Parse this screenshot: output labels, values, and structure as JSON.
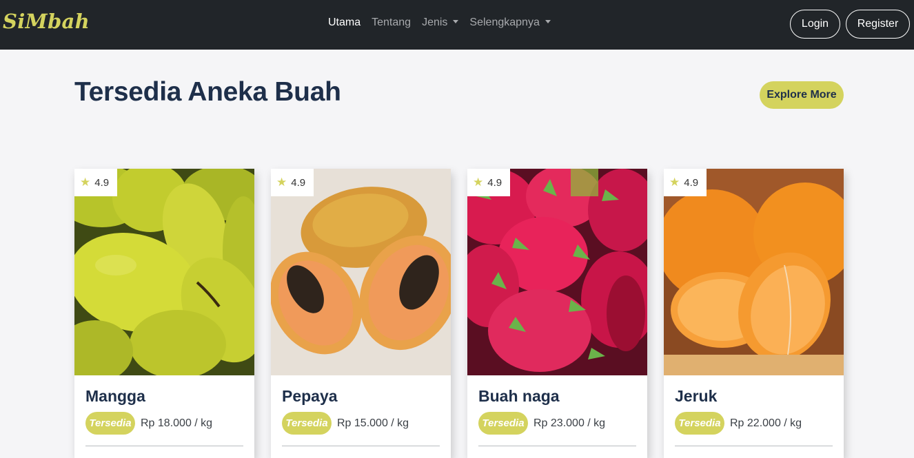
{
  "navbar": {
    "brand": "SiMbah",
    "links": [
      {
        "label": "Utama",
        "active": true,
        "dropdown": false
      },
      {
        "label": "Tentang",
        "active": false,
        "dropdown": false
      },
      {
        "label": "Jenis",
        "active": false,
        "dropdown": true
      },
      {
        "label": "Selengkapnya",
        "active": false,
        "dropdown": true
      }
    ],
    "login_label": "Login",
    "register_label": "Register"
  },
  "section": {
    "title": "Tersedia Aneka Buah",
    "explore_label": "Explore More"
  },
  "products": [
    {
      "name": "Mangga",
      "rating": "4.9",
      "status": "Tersedia",
      "price": "Rp 18.000 / kg",
      "image": "mango-photo"
    },
    {
      "name": "Pepaya",
      "rating": "4.9",
      "status": "Tersedia",
      "price": "Rp 15.000 / kg",
      "image": "papaya-photo"
    },
    {
      "name": "Buah naga",
      "rating": "4.9",
      "status": "Tersedia",
      "price": "Rp 23.000 / kg",
      "image": "dragon-fruit-photo"
    },
    {
      "name": "Jeruk",
      "rating": "4.9",
      "status": "Tersedia",
      "price": "Rp 22.000 / kg",
      "image": "orange-photo"
    }
  ],
  "colors": {
    "navbar_bg": "#212529",
    "accent": "#d4d35e",
    "heading": "#1e2f4a",
    "page_bg": "#f5f5f7"
  },
  "icons": [
    "star-icon",
    "chevron-down-icon"
  ]
}
